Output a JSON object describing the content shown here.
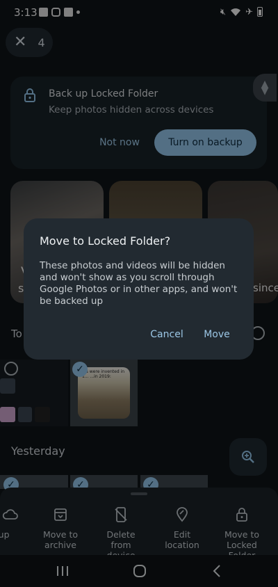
{
  "status_bar": {
    "time": "3:13",
    "left_icons": [
      "gallery-icon",
      "instagram-icon",
      "trello-icon",
      "dot-icon"
    ],
    "right_icons": [
      "mute-icon",
      "wifi-icon",
      "airplane-icon",
      "battery-icon"
    ]
  },
  "selection": {
    "count": "4",
    "close_icon": "close-icon"
  },
  "backup_card": {
    "title": "Back up Locked Folder",
    "subtitle": "Keep photos hidden across devices",
    "not_now": "Not now",
    "turn_on": "Turn on backup"
  },
  "photo_peek": {
    "v": "V",
    "s": "s",
    "since": "since"
  },
  "sections": {
    "today": "To",
    "yesterday": "Yesterday"
  },
  "selected_thumb_caption": "...s were invented in 1... ...in 2019:",
  "dialog": {
    "title": "Move to Locked Folder?",
    "body": "These photos and videos will be hidden and won't show as you scroll through Google Photos or in other apps, and won't be backed up",
    "cancel": "Cancel",
    "move": "Move"
  },
  "actions": [
    {
      "label": "k up",
      "icon": "cloud-upload-icon"
    },
    {
      "label": "Move to archive",
      "icon": "archive-icon"
    },
    {
      "label": "Delete from device",
      "icon": "phone-delete-icon"
    },
    {
      "label": "Edit location",
      "icon": "location-edit-icon"
    },
    {
      "label": "Move to Locked Folder",
      "icon": "lock-icon"
    }
  ],
  "colors": {
    "accent": "#8fc0e3",
    "background": "#0f1418",
    "dialog": "#222a31"
  }
}
